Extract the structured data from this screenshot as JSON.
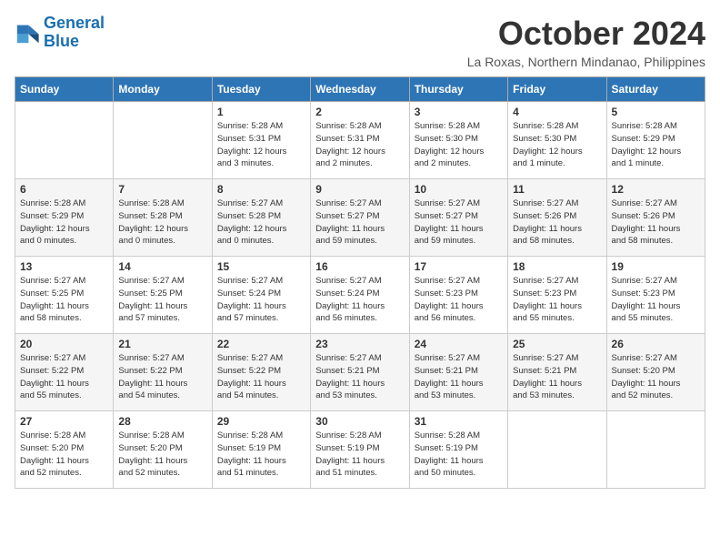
{
  "logo": {
    "line1": "General",
    "line2": "Blue"
  },
  "title": "October 2024",
  "location": "La Roxas, Northern Mindanao, Philippines",
  "headers": [
    "Sunday",
    "Monday",
    "Tuesday",
    "Wednesday",
    "Thursday",
    "Friday",
    "Saturday"
  ],
  "weeks": [
    [
      {
        "day": "",
        "detail": ""
      },
      {
        "day": "",
        "detail": ""
      },
      {
        "day": "1",
        "detail": "Sunrise: 5:28 AM\nSunset: 5:31 PM\nDaylight: 12 hours\nand 3 minutes."
      },
      {
        "day": "2",
        "detail": "Sunrise: 5:28 AM\nSunset: 5:31 PM\nDaylight: 12 hours\nand 2 minutes."
      },
      {
        "day": "3",
        "detail": "Sunrise: 5:28 AM\nSunset: 5:30 PM\nDaylight: 12 hours\nand 2 minutes."
      },
      {
        "day": "4",
        "detail": "Sunrise: 5:28 AM\nSunset: 5:30 PM\nDaylight: 12 hours\nand 1 minute."
      },
      {
        "day": "5",
        "detail": "Sunrise: 5:28 AM\nSunset: 5:29 PM\nDaylight: 12 hours\nand 1 minute."
      }
    ],
    [
      {
        "day": "6",
        "detail": "Sunrise: 5:28 AM\nSunset: 5:29 PM\nDaylight: 12 hours\nand 0 minutes."
      },
      {
        "day": "7",
        "detail": "Sunrise: 5:28 AM\nSunset: 5:28 PM\nDaylight: 12 hours\nand 0 minutes."
      },
      {
        "day": "8",
        "detail": "Sunrise: 5:27 AM\nSunset: 5:28 PM\nDaylight: 12 hours\nand 0 minutes."
      },
      {
        "day": "9",
        "detail": "Sunrise: 5:27 AM\nSunset: 5:27 PM\nDaylight: 11 hours\nand 59 minutes."
      },
      {
        "day": "10",
        "detail": "Sunrise: 5:27 AM\nSunset: 5:27 PM\nDaylight: 11 hours\nand 59 minutes."
      },
      {
        "day": "11",
        "detail": "Sunrise: 5:27 AM\nSunset: 5:26 PM\nDaylight: 11 hours\nand 58 minutes."
      },
      {
        "day": "12",
        "detail": "Sunrise: 5:27 AM\nSunset: 5:26 PM\nDaylight: 11 hours\nand 58 minutes."
      }
    ],
    [
      {
        "day": "13",
        "detail": "Sunrise: 5:27 AM\nSunset: 5:25 PM\nDaylight: 11 hours\nand 58 minutes."
      },
      {
        "day": "14",
        "detail": "Sunrise: 5:27 AM\nSunset: 5:25 PM\nDaylight: 11 hours\nand 57 minutes."
      },
      {
        "day": "15",
        "detail": "Sunrise: 5:27 AM\nSunset: 5:24 PM\nDaylight: 11 hours\nand 57 minutes."
      },
      {
        "day": "16",
        "detail": "Sunrise: 5:27 AM\nSunset: 5:24 PM\nDaylight: 11 hours\nand 56 minutes."
      },
      {
        "day": "17",
        "detail": "Sunrise: 5:27 AM\nSunset: 5:23 PM\nDaylight: 11 hours\nand 56 minutes."
      },
      {
        "day": "18",
        "detail": "Sunrise: 5:27 AM\nSunset: 5:23 PM\nDaylight: 11 hours\nand 55 minutes."
      },
      {
        "day": "19",
        "detail": "Sunrise: 5:27 AM\nSunset: 5:23 PM\nDaylight: 11 hours\nand 55 minutes."
      }
    ],
    [
      {
        "day": "20",
        "detail": "Sunrise: 5:27 AM\nSunset: 5:22 PM\nDaylight: 11 hours\nand 55 minutes."
      },
      {
        "day": "21",
        "detail": "Sunrise: 5:27 AM\nSunset: 5:22 PM\nDaylight: 11 hours\nand 54 minutes."
      },
      {
        "day": "22",
        "detail": "Sunrise: 5:27 AM\nSunset: 5:22 PM\nDaylight: 11 hours\nand 54 minutes."
      },
      {
        "day": "23",
        "detail": "Sunrise: 5:27 AM\nSunset: 5:21 PM\nDaylight: 11 hours\nand 53 minutes."
      },
      {
        "day": "24",
        "detail": "Sunrise: 5:27 AM\nSunset: 5:21 PM\nDaylight: 11 hours\nand 53 minutes."
      },
      {
        "day": "25",
        "detail": "Sunrise: 5:27 AM\nSunset: 5:21 PM\nDaylight: 11 hours\nand 53 minutes."
      },
      {
        "day": "26",
        "detail": "Sunrise: 5:27 AM\nSunset: 5:20 PM\nDaylight: 11 hours\nand 52 minutes."
      }
    ],
    [
      {
        "day": "27",
        "detail": "Sunrise: 5:28 AM\nSunset: 5:20 PM\nDaylight: 11 hours\nand 52 minutes."
      },
      {
        "day": "28",
        "detail": "Sunrise: 5:28 AM\nSunset: 5:20 PM\nDaylight: 11 hours\nand 52 minutes."
      },
      {
        "day": "29",
        "detail": "Sunrise: 5:28 AM\nSunset: 5:19 PM\nDaylight: 11 hours\nand 51 minutes."
      },
      {
        "day": "30",
        "detail": "Sunrise: 5:28 AM\nSunset: 5:19 PM\nDaylight: 11 hours\nand 51 minutes."
      },
      {
        "day": "31",
        "detail": "Sunrise: 5:28 AM\nSunset: 5:19 PM\nDaylight: 11 hours\nand 50 minutes."
      },
      {
        "day": "",
        "detail": ""
      },
      {
        "day": "",
        "detail": ""
      }
    ]
  ]
}
